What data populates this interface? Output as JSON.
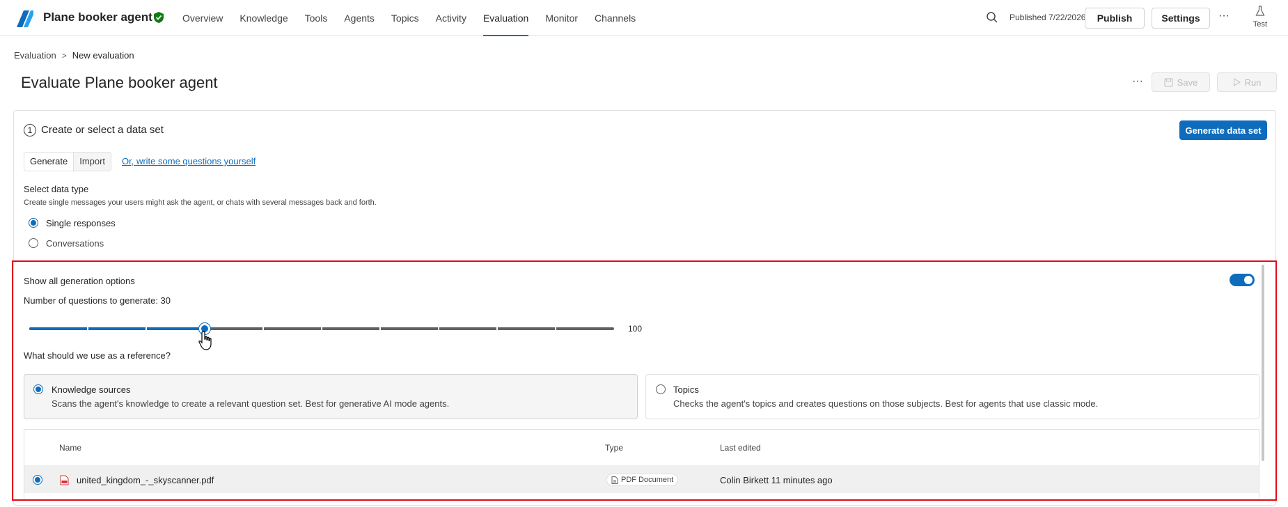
{
  "header": {
    "app_title": "Plane booker agent",
    "nav": [
      "Overview",
      "Knowledge",
      "Tools",
      "Agents",
      "Topics",
      "Activity",
      "Evaluation",
      "Monitor",
      "Channels"
    ],
    "active_nav": "Evaluation",
    "published": "Published 7/22/2026",
    "publish_label": "Publish",
    "settings_label": "Settings",
    "more_label": "···",
    "test_label": "Test"
  },
  "breadcrumb": {
    "parent": "Evaluation",
    "separator": ">",
    "current": "New evaluation"
  },
  "page": {
    "title": "Evaluate Plane booker agent",
    "more_label": "···",
    "save_label": "Save",
    "run_label": "Run"
  },
  "step": {
    "number": "1",
    "title": "Create or select a data set",
    "generate_button": "Generate data set",
    "tabs": [
      "Generate",
      "Import"
    ],
    "write_link": "Or, write some questions yourself",
    "data_type_title": "Select data type",
    "data_type_desc": "Create single messages your users might ask the agent, or chats with several messages back and forth.",
    "options": [
      {
        "label": "Single responses",
        "checked": true
      },
      {
        "label": "Conversations",
        "checked": false
      }
    ]
  },
  "generation": {
    "show_all_label": "Show all generation options",
    "toggle_on": true,
    "num_questions_label": "Number of questions to generate: 30",
    "slider_value": 30,
    "slider_max": 100,
    "slider_max_label": "100",
    "reference_title": "What should we use as a reference?",
    "references": [
      {
        "name": "Knowledge sources",
        "desc": "Scans the agent's knowledge to create a relevant question set. Best for generative AI mode agents.",
        "selected": true
      },
      {
        "name": "Topics",
        "desc": "Checks the agent's topics and creates questions on those subjects. Best for agents that use classic mode.",
        "selected": false
      }
    ]
  },
  "table": {
    "columns": [
      "Name",
      "Type",
      "Last edited"
    ],
    "rows": [
      {
        "name": "united_kingdom_-_skyscanner.pdf",
        "type": "PDF Document",
        "last_edited": "Colin Birkett 11 minutes ago"
      }
    ]
  },
  "colors": {
    "accent": "#0f6cbd",
    "highlight": "#e00b1c"
  }
}
